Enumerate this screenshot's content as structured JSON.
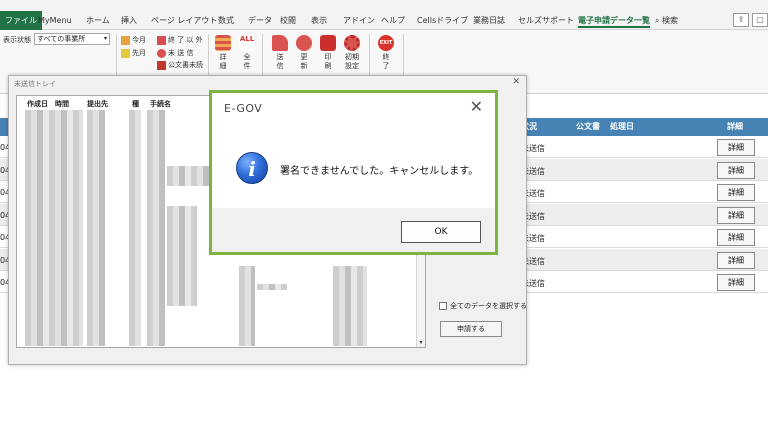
{
  "tabs": [
    "ファイル",
    "MyMenu",
    "ホーム",
    "挿入",
    "ページ レイアウト",
    "数式",
    "データ",
    "校閲",
    "表示",
    "アドイン",
    "ヘルプ",
    "Cellsドライブ",
    "業務日誌",
    "セルズサポート",
    "電子申請データ一覧"
  ],
  "search_label": "検索",
  "ribbon": {
    "display_state_label": "表示状態",
    "display_state_value": "すべての事業所",
    "this_month": "今月",
    "prev_month": "先月",
    "except_done": "終 了 以 外",
    "unsent": "未 送 信",
    "official_unread": "公文書未読",
    "detail": "詳細",
    "all_items": "全件",
    "send": "送信",
    "update": "更新",
    "print": "印刷",
    "init_settings": "初期設定",
    "exit": "終了",
    "exit_icon_text": "EXIT",
    "all_icon_text": "ALL"
  },
  "sheet": {
    "headers": [
      "状況",
      "公文書",
      "処理日",
      "詳細"
    ],
    "rows": [
      {
        "lead": "04",
        "status": "未送信",
        "button": "詳細"
      },
      {
        "lead": "04",
        "status": "未送信",
        "button": "詳細"
      },
      {
        "lead": "04",
        "status": "未送信",
        "button": "詳細"
      },
      {
        "lead": "04",
        "status": "未送信",
        "button": "詳細"
      },
      {
        "lead": "04",
        "status": "未送信",
        "button": "詳細"
      },
      {
        "lead": "04",
        "status": "未送信",
        "button": "詳細"
      },
      {
        "lead": "04",
        "status": "未送信",
        "button": "詳細"
      }
    ]
  },
  "tray": {
    "title": "未送信トレイ",
    "columns": [
      "作成日",
      "時間",
      "提出先",
      "種",
      "手続名"
    ],
    "select_all_label": "全てのデータを選択する",
    "apply_button": "申請する"
  },
  "dialog": {
    "title": "E-GOV",
    "message": "署名できませんでした。キャンセルします。",
    "ok_button": "OK",
    "border_color": "#7cb342"
  },
  "colors": {
    "excel_green": "#217346",
    "header_blue": "#4682b4"
  }
}
